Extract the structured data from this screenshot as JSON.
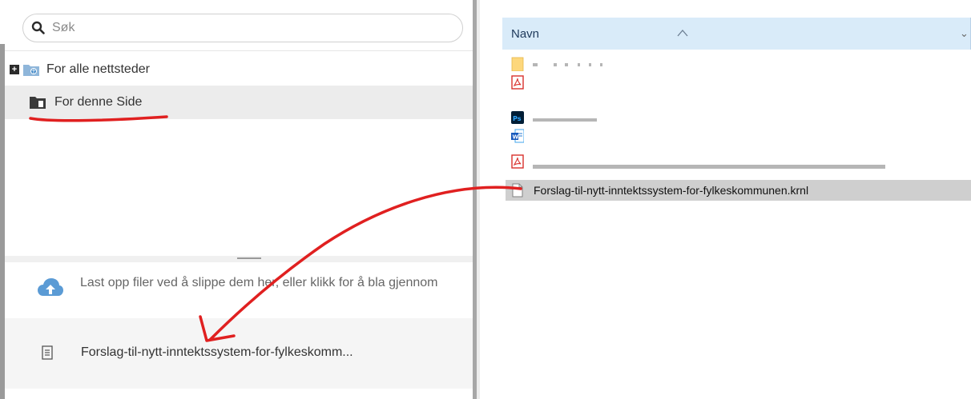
{
  "search": {
    "placeholder": "Søk"
  },
  "tree": {
    "items": [
      {
        "label": "For alle nettsteder",
        "icon": "globe-folder-icon"
      },
      {
        "label": "For denne Side",
        "icon": "page-folder-icon"
      }
    ]
  },
  "upload": {
    "text": "Last opp filer ved å slippe dem her, eller klikk for å bla gjennom",
    "file": "Forslag-til-nytt-inntektssystem-for-fylkeskomm..."
  },
  "explorer": {
    "column_header": "Navn",
    "files": [
      {
        "name": "",
        "icon": "folder-icon"
      },
      {
        "name": "",
        "icon": "pdf-icon"
      },
      {
        "name": "",
        "icon": "photoshop-icon"
      },
      {
        "name": "",
        "icon": "word-icon"
      },
      {
        "name": "",
        "icon": "pdf-icon"
      },
      {
        "name": "Forslag-til-nytt-inntektssystem-for-fylkeskommunen.krnl",
        "icon": "document-icon"
      }
    ]
  },
  "colors": {
    "annotation": "#e02020",
    "selection": "#cfcfcf",
    "header": "#d9ebf9"
  }
}
